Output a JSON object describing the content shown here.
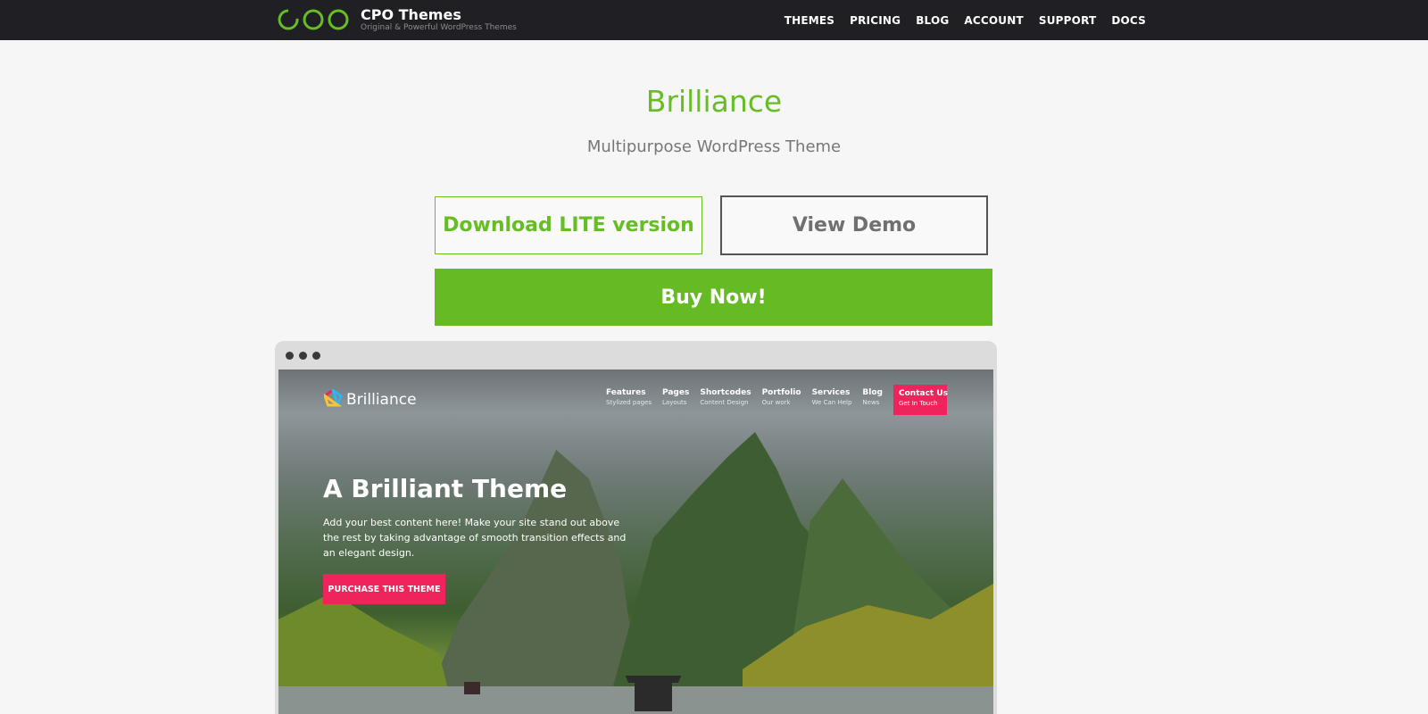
{
  "brand": {
    "name": "CPO Themes",
    "tagline": "Original & Powerful WordPress Themes",
    "color": "#67bd24"
  },
  "nav": {
    "items": [
      "THEMES",
      "PRICING",
      "BLOG",
      "ACCOUNT",
      "SUPPORT",
      "DOCS"
    ]
  },
  "hero": {
    "title": "Brilliance",
    "subtitle": "Multipurpose WordPress Theme"
  },
  "buttons": {
    "download_lite": "Download LITE version",
    "view_demo": "View Demo",
    "buy_now": "Buy Now!"
  },
  "preview": {
    "brand": "Brilliance",
    "nav": [
      {
        "title": "Features",
        "sub": "Stylized pages"
      },
      {
        "title": "Pages",
        "sub": "Layouts"
      },
      {
        "title": "Shortcodes",
        "sub": "Content Design"
      },
      {
        "title": "Portfolio",
        "sub": "Our work"
      },
      {
        "title": "Services",
        "sub": "We Can Help"
      },
      {
        "title": "Blog",
        "sub": "News"
      }
    ],
    "contact": {
      "title": "Contact Us",
      "sub": "Get In Touch"
    },
    "headline": "A Brilliant Theme",
    "body": "Add your best content here! Make your site stand out above the rest by taking advantage of smooth transition effects and an elegant design.",
    "cta": "PURCHASE THIS THEME",
    "accent": "#f0245c"
  }
}
